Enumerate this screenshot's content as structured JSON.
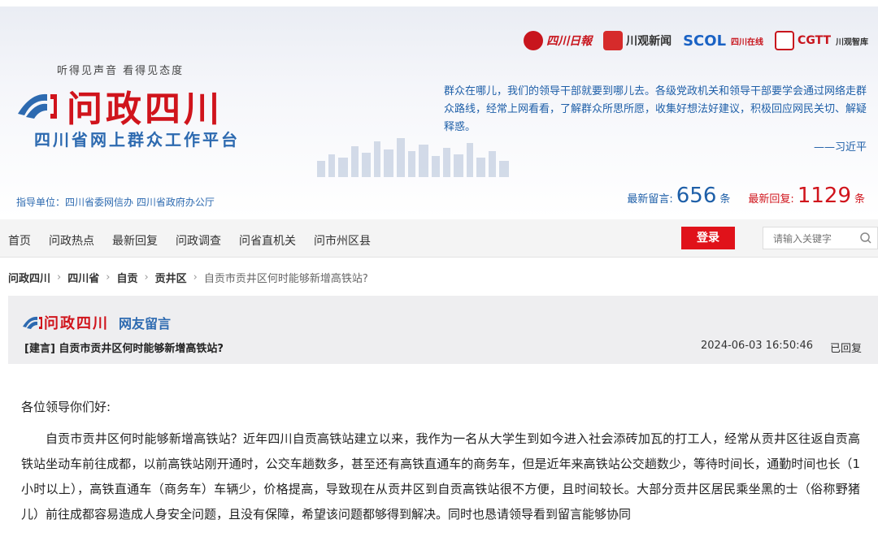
{
  "header": {
    "slogan": "听得见声音  看得见态度",
    "site_title": "问政四川",
    "sub_title": "四川省网上群众工作平台",
    "guide": "指导单位：四川省委网信办 四川省政府办公厅",
    "partners": [
      {
        "name": "四川日報"
      },
      {
        "name": "川观新闻"
      },
      {
        "name": "SCOL",
        "sub": "四川在线"
      },
      {
        "name": "CGTT",
        "sub": "川观智库"
      }
    ],
    "quote": "群众在哪儿，我们的领导干部就要到哪儿去。各级党政机关和领导干部要学会通过网络走群众路线，经常上网看看，了解群众所思所愿，收集好想法好建议，积极回应网民关切、解疑释惑。",
    "quote_author": "——习近平",
    "stats": {
      "latest_msg_label": "最新留言:",
      "latest_msg_count": "656",
      "latest_msg_unit": "条",
      "latest_reply_label": "最新回复:",
      "latest_reply_count": "1129",
      "latest_reply_unit": "条"
    }
  },
  "nav": {
    "items": [
      "首页",
      "问政热点",
      "最新回复",
      "问政调查",
      "问省直机关",
      "问市州区县"
    ],
    "login": "登录",
    "search_placeholder": "请输入关键字"
  },
  "breadcrumb": {
    "items": [
      "问政四川",
      "四川省",
      "自贡",
      "贡井区"
    ],
    "current": "自贡市贡井区何时能够新增高铁站?"
  },
  "panel": {
    "logo_text": "问政四川",
    "section": "网友留言",
    "title": "[建言] 自贡市贡井区何时能够新增高铁站?",
    "time": "2024-06-03 16:50:46",
    "status": "已回复"
  },
  "content": {
    "greeting": "各位领导你们好:",
    "paragraph": "自贡市贡井区何时能够新增高铁站？近年四川自贡高铁站建立以来，我作为一名从大学生到如今进入社会添砖加瓦的打工人，经常从贡井区往返自贡高铁站坐动车前往成都，以前高铁站刚开通时，公交车趟数多，甚至还有高铁直通车的商务车，但是近年来高铁站公交趟数少，等待时间长，通勤时间也长（1小时以上），高铁直通车（商务车）车辆少，价格提高，导致现在从贡井区到自贡高铁站很不方便，且时间较长。大部分贡井区居民乘坐黑的士（俗称野猪儿）前往成都容易造成人身安全问题，且没有保障，希望该问题都够得到解决。同时也恳请领导看到留言能够协同"
  },
  "colors": {
    "brand_red": "#d0141c",
    "brand_blue": "#2d6ab0",
    "login_red": "#e0121a"
  }
}
